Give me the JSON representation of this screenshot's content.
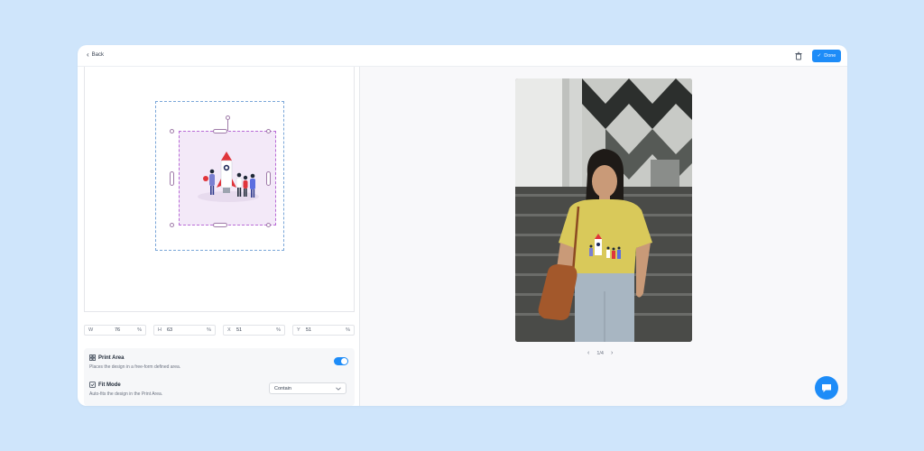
{
  "header": {
    "back_label": "Back",
    "done_label": "Done",
    "done_check": "✓"
  },
  "colors": {
    "accent": "#1d8cf8",
    "background": "#cfe5fb",
    "design_fill": "#f3e9f8",
    "shirt": "#d9c95a"
  },
  "icons": {
    "back": "chevron-left-icon",
    "delete": "trash-icon",
    "done": "check-icon",
    "print_area": "print-area-icon",
    "fit_mode": "fit-mode-icon",
    "select": "chevron-down-icon",
    "chat": "chat-icon"
  },
  "dimensions": {
    "w": {
      "label": "W",
      "value": "76",
      "unit": "%"
    },
    "h": {
      "label": "H",
      "value": "63",
      "unit": "%"
    },
    "x": {
      "label": "X",
      "value": "51",
      "unit": "%"
    },
    "y": {
      "label": "Y",
      "value": "51",
      "unit": "%"
    }
  },
  "options": {
    "print_area": {
      "title": "Print Area",
      "description": "Places the design in a free-form defined area.",
      "enabled": true
    },
    "fit_mode": {
      "title": "Fit Mode",
      "description": "Auto-fits the design in the Print Area.",
      "selected": "Contain"
    }
  },
  "preview": {
    "pager": "1/4"
  }
}
